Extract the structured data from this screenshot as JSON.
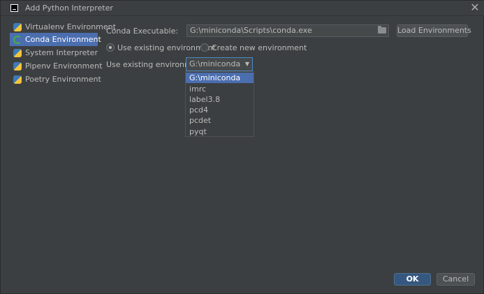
{
  "window": {
    "title": "Add Python Interpreter"
  },
  "sidebar": {
    "items": [
      {
        "label": "Virtualenv Environment",
        "icon": "python-icon"
      },
      {
        "label": "Conda Environment",
        "icon": "conda-icon",
        "selected": true
      },
      {
        "label": "System Interpreter",
        "icon": "python-icon"
      },
      {
        "label": "Pipenv Environment",
        "icon": "python-icon"
      },
      {
        "label": "Poetry Environment",
        "icon": "python-icon"
      }
    ]
  },
  "main": {
    "conda_executable_label": "Conda Executable:",
    "conda_executable_value": "G:\\miniconda\\Scripts\\conda.exe",
    "load_environments_label": "Load Environments",
    "radio_use_existing": "Use existing environment",
    "radio_create_new": "Create new environment",
    "use_existing_label": "Use existing environment:",
    "selected_env": "G:\\miniconda",
    "env_options": [
      "G:\\miniconda",
      "imrc",
      "label3.8",
      "pcd4",
      "pcdet",
      "pyqt"
    ]
  },
  "footer": {
    "ok_label": "OK",
    "cancel_label": "Cancel"
  },
  "colors": {
    "accent": "#4b6eaf",
    "background": "#3c3f41",
    "text": "#bbbbbb"
  }
}
